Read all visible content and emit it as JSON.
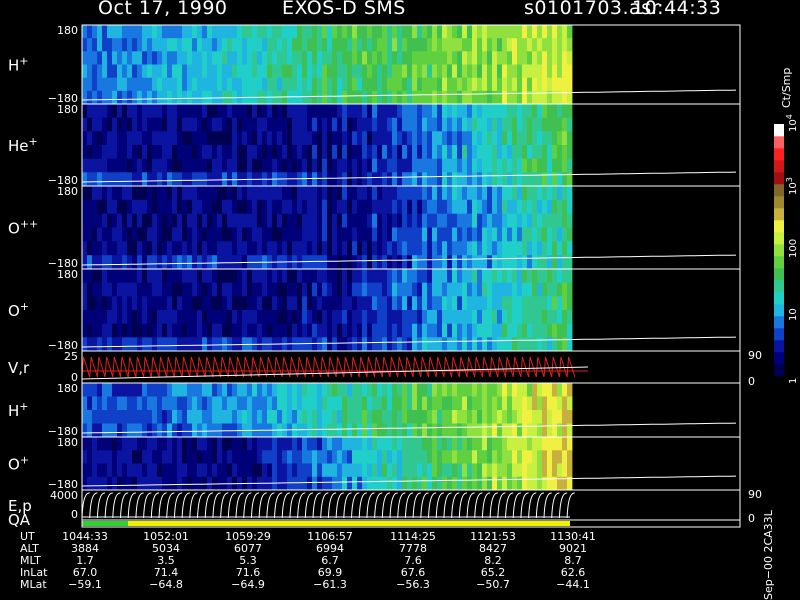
{
  "header": {
    "date": "Oct 17, 1990",
    "instrument": "EXOS-D SMS",
    "file": "s0101703.asr",
    "time": "10:44:33"
  },
  "chart_data": {
    "type": "heatmap",
    "colors": {
      "background": "#000000",
      "track": "#ffffff",
      "velocity": "#e02020",
      "qa_bar": "#f0f000",
      "qa_start": "#30d030"
    },
    "panels": [
      {
        "id": "h-plus-1",
        "species": "H",
        "charge": "+",
        "ymax": "180",
        "ymin": "−180",
        "profile": "h"
      },
      {
        "id": "he-plus",
        "species": "He",
        "charge": "+",
        "ymax": "180",
        "ymin": "−180",
        "profile": "he"
      },
      {
        "id": "o-plusplus",
        "species": "O",
        "charge": "++",
        "ymax": "180",
        "ymin": "−180",
        "profile": "opp"
      },
      {
        "id": "o-plus-1",
        "species": "O",
        "charge": "+",
        "ymax": "180",
        "ymin": "−180",
        "profile": "op"
      },
      {
        "id": "vr",
        "species": "V,r",
        "charge": "",
        "ymax": "25",
        "ymin": "0",
        "right_max": "90",
        "right_min": "0",
        "profile": "line"
      },
      {
        "id": "h-plus-2",
        "species": "H",
        "charge": "+",
        "ymax": "180",
        "ymin": "−180",
        "profile": "h2"
      },
      {
        "id": "o-plus-2",
        "species": "O",
        "charge": "+",
        "ymax": "180",
        "ymin": "−180",
        "profile": "o2"
      },
      {
        "id": "ep",
        "species": "E,p",
        "charge": "",
        "ymax": "4000",
        "ymin": "0",
        "right_max": "90",
        "right_min": "0",
        "profile": "line2"
      }
    ],
    "qa_label": "QA",
    "colorbar": {
      "title": "Ct/Smp",
      "ticks": [
        {
          "value": 1,
          "label": "1",
          "exp": ""
        },
        {
          "value": 10,
          "label": "10",
          "exp": ""
        },
        {
          "value": 100,
          "label": "100",
          "exp": ""
        },
        {
          "value": 1000,
          "label": "10",
          "exp": "3"
        },
        {
          "value": 10000,
          "label": "10",
          "exp": "4"
        }
      ],
      "range": [
        1,
        10000
      ],
      "scale": "log"
    },
    "colormap": [
      "#000050",
      "#000078",
      "#0a14a0",
      "#1040c8",
      "#1878e0",
      "#20b4e0",
      "#20d0c8",
      "#30c890",
      "#40c050",
      "#60d040",
      "#90e040",
      "#c8f040",
      "#f0f040",
      "#c8b040",
      "#a08830",
      "#806828",
      "#a01010",
      "#d01818",
      "#ff2020",
      "#ff6060",
      "#ffffff"
    ]
  },
  "ephemeris": {
    "rows": [
      {
        "label": "UT",
        "values": [
          "1044:33",
          "1052:01",
          "1059:29",
          "1106:57",
          "1114:25",
          "1121:53",
          "1130:41"
        ]
      },
      {
        "label": "ALT",
        "values": [
          "3884",
          "5034",
          "6077",
          "6994",
          "7778",
          "8427",
          "9021"
        ]
      },
      {
        "label": "MLT",
        "values": [
          "1.7",
          "3.5",
          "5.3",
          "6.7",
          "7.6",
          "8.2",
          "8.7"
        ]
      },
      {
        "label": "InLat",
        "values": [
          "67.0",
          "71.4",
          "71.6",
          "69.9",
          "67.6",
          "65.2",
          "62.6"
        ]
      },
      {
        "label": "MLat",
        "values": [
          "−59.1",
          "−64.8",
          "−64.9",
          "−61.3",
          "−56.3",
          "−50.7",
          "−44.1"
        ]
      }
    ]
  },
  "side_note": "Sep−00  2CA33L"
}
